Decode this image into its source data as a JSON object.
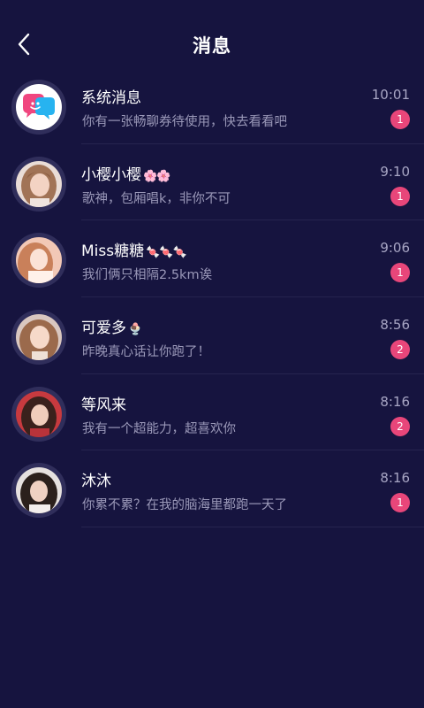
{
  "header": {
    "title": "消息",
    "back_icon": "chevron-left-icon"
  },
  "colors": {
    "background": "#16143f",
    "badge": "#e8467a",
    "secondary_text": "#9a98b8"
  },
  "conversations": [
    {
      "name": "系统消息",
      "emoji": "",
      "message": "你有一张畅聊券待使用，快去看看吧",
      "time": "10:01",
      "unread": "1"
    },
    {
      "name": "小樱小樱",
      "emoji": "🌸🌸",
      "message": "歌神，包厢唱k，非你不可",
      "time": "9:10",
      "unread": "1"
    },
    {
      "name": "Miss糖糖",
      "emoji": "🍬🍬🍬",
      "message": "我们俩只相隔2.5km诶",
      "time": "9:06",
      "unread": "1"
    },
    {
      "name": "可爱多",
      "emoji": "🍨",
      "message": "昨晚真心话让你跑了！",
      "time": "8:56",
      "unread": "2"
    },
    {
      "name": "等风来",
      "emoji": "",
      "message": "我有一个超能力，超喜欢你",
      "time": "8:16",
      "unread": "2"
    },
    {
      "name": "沐沐",
      "emoji": "",
      "message": "你累不累？在我的脑海里都跑一天了",
      "time": "8:16",
      "unread": "1"
    }
  ]
}
